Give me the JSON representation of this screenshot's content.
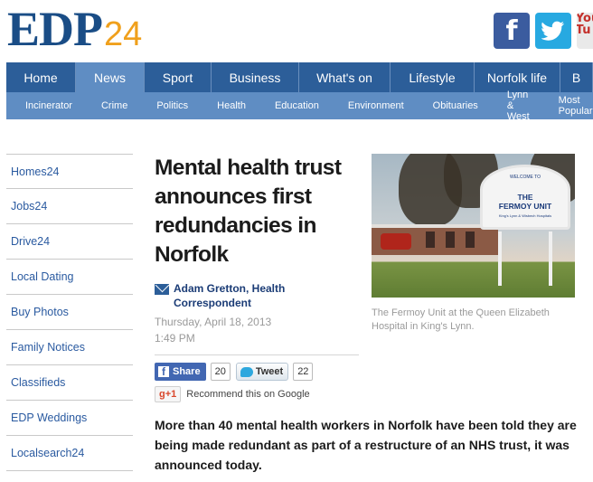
{
  "logo": {
    "main": "EDP",
    "suffix": "24"
  },
  "social": {
    "facebook_glyph": "f",
    "youtube_text": "You Tu"
  },
  "nav_primary": [
    {
      "label": "Home",
      "width": 77
    },
    {
      "label": "News",
      "width": 76
    },
    {
      "label": "Sport",
      "width": 74
    },
    {
      "label": "Business",
      "width": 97
    },
    {
      "label": "What's on",
      "width": 101
    },
    {
      "label": "Lifestyle",
      "width": 93
    },
    {
      "label": "Norfolk life",
      "width": 95
    },
    {
      "label": "B",
      "width": 36
    }
  ],
  "nav_secondary": [
    "Incinerator",
    "Crime",
    "Politics",
    "Health",
    "Education",
    "Environment",
    "Obituaries",
    "Lynn & West",
    "Most Popular"
  ],
  "sidebar": [
    "Homes24",
    "Jobs24",
    "Drive24",
    "Local Dating",
    "Buy Photos",
    "Family Notices",
    "Classifieds",
    "EDP Weddings",
    "Localsearch24"
  ],
  "article": {
    "headline": "Mental health trust announces first redundancies in Norfolk",
    "author": "Adam Gretton, Health Correspondent",
    "date": "Thursday, April 18, 2013",
    "time": "1:49 PM",
    "lede": "More than 40 mental health workers in Norfolk have been told they are being made redundant as part of a restructure of an NHS trust, it was announced today."
  },
  "share": {
    "fb_label": "Share",
    "fb_count": "20",
    "tweet_label": "Tweet",
    "tweet_count": "22",
    "gplus_label": "+1",
    "gplus_text": "Recommend this on Google"
  },
  "photo": {
    "sign_welcome": "WELCOME TO",
    "sign_name_line1": "THE",
    "sign_name_line2": "FERMOY UNIT",
    "sign_sub": "King's Lynn & Wisbech Hospitals",
    "caption": "The Fermoy Unit at the Queen Elizabeth Hospital in King's Lynn."
  },
  "colors": {
    "brand_blue": "#2c5e99",
    "nav_secondary": "#5f8dc3",
    "logo_orange": "#f0a01c"
  }
}
